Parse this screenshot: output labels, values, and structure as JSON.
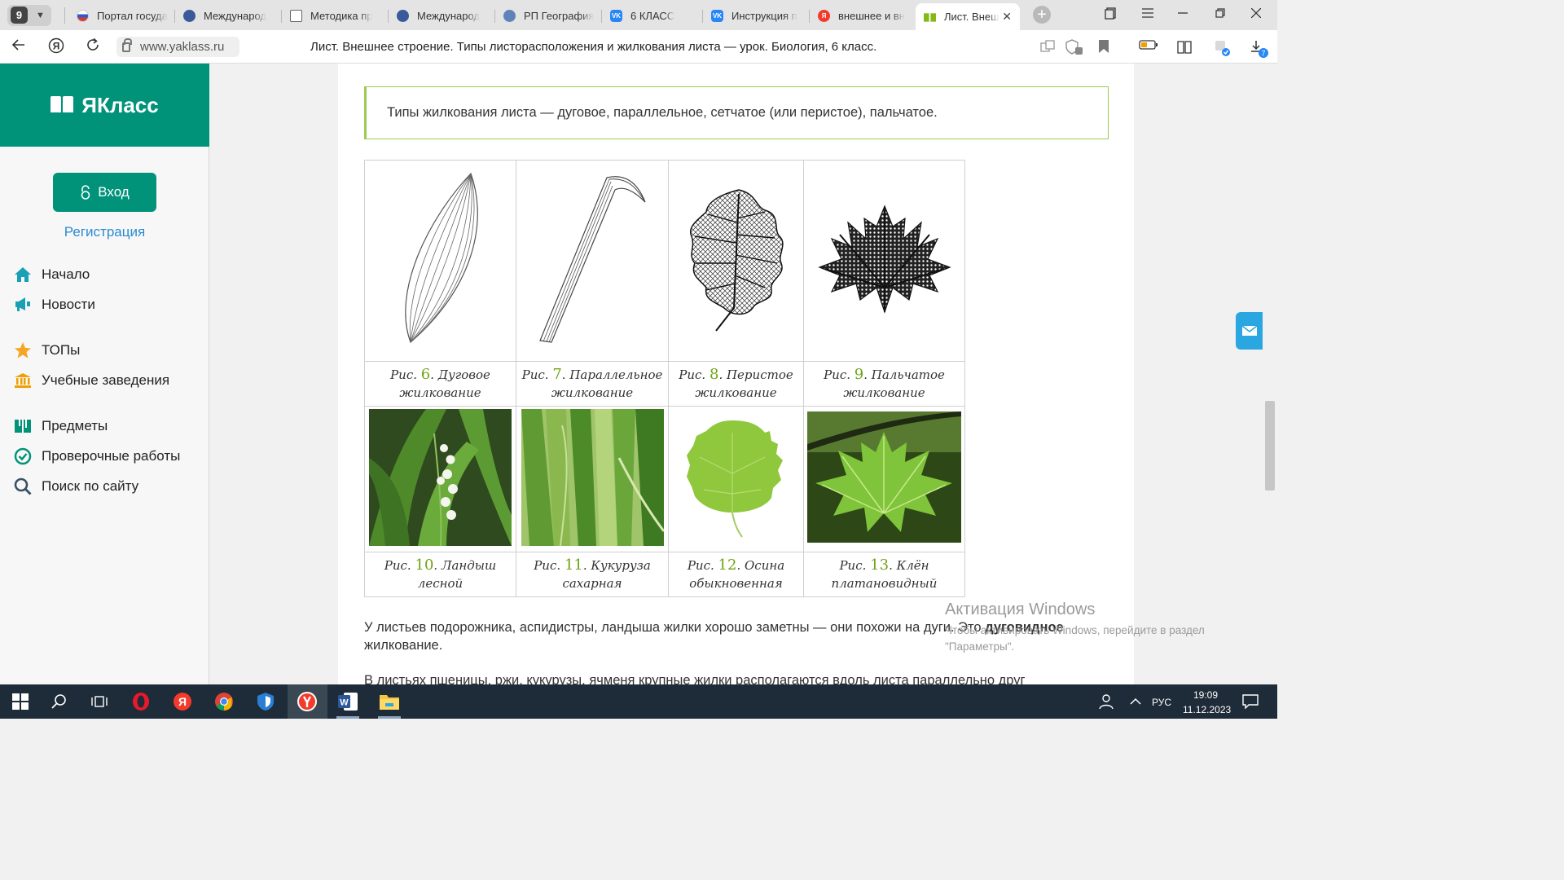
{
  "tabbar": {
    "tab_count": "9",
    "tabs": [
      {
        "label": "Портал госуда",
        "fav_color": "#3b5bdb"
      },
      {
        "label": "Международ",
        "fav_color": "#3a5a99"
      },
      {
        "label": "Методика пр",
        "fav_color": "#888888"
      },
      {
        "label": "Международ",
        "fav_color": "#3a5a99"
      },
      {
        "label": "РП География",
        "fav_color": "#5f83b8"
      },
      {
        "label": "6 КЛАСС",
        "fav_color": "#2787f5"
      },
      {
        "label": "Инструкция п",
        "fav_color": "#2787f5"
      },
      {
        "label": "внешнее и вн",
        "fav_color": "#f33b2c"
      },
      {
        "label": "Лист. Внеш",
        "fav_color": "#86b817"
      }
    ]
  },
  "addressbar": {
    "url": "www.yaklass.ru",
    "page_title": "Лист. Внешнее строение. Типы листорасположения и жилкования листа — урок. Биология, 6 класс.",
    "extension_badge": "7"
  },
  "sidebar": {
    "brand": "ЯКласс",
    "login_label": "Вход",
    "register_label": "Регистрация",
    "menu": [
      {
        "label": "Начало",
        "icon": "home-icon"
      },
      {
        "label": "Новости",
        "icon": "news-icon"
      },
      {
        "label": "ТОПы",
        "icon": "star-icon"
      },
      {
        "label": "Учебные заведения",
        "icon": "school-icon"
      },
      {
        "label": "Предметы",
        "icon": "book-icon"
      },
      {
        "label": "Проверочные работы",
        "icon": "check-icon"
      },
      {
        "label": "Поиск по сайту",
        "icon": "search-icon"
      }
    ]
  },
  "content": {
    "callout": "Типы жилкования листа — дуговое, параллельное, сетчатое (или перистое), пальчатое.",
    "figures_row1": [
      {
        "prefix": "Рис.",
        "num": "6",
        "caption": ". Дуговое жилкование"
      },
      {
        "prefix": "Рис.",
        "num": "7",
        "caption": ". Параллельное жилкование"
      },
      {
        "prefix": "Рис.",
        "num": "8",
        "caption": ". Перистое жилкование"
      },
      {
        "prefix": "Рис.",
        "num": "9",
        "caption": ". Пальчатое жилкование"
      }
    ],
    "figures_row2": [
      {
        "prefix": "Рис.",
        "num": "10",
        "caption": ". Ландыш лесной"
      },
      {
        "prefix": "Рис.",
        "num": "11",
        "caption": ". Кукуруза сахарная"
      },
      {
        "prefix": "Рис.",
        "num": "12",
        "caption": ". Осина обыкновенная"
      },
      {
        "prefix": "Рис.",
        "num": "13",
        "caption": ". Клён платановидный"
      }
    ],
    "para1_start": "У листьев подорожника, аспидистры, ландыша жилки хорошо заметны — они похожи на дуги. Это ",
    "para1_bold": "дуговидное",
    "para1_end": " жилкование.",
    "para2": "В листьях пшеницы, ржи, кукурузы, ячменя крупные жилки располагаются вдоль листа параллельно друг"
  },
  "watermark": {
    "title": "Активация Windows",
    "text": "Чтобы активировать Windows, перейдите в раздел \"Параметры\"."
  },
  "taskbar": {
    "lang": "РУС",
    "time": "19:09",
    "date": "11.12.2023"
  }
}
